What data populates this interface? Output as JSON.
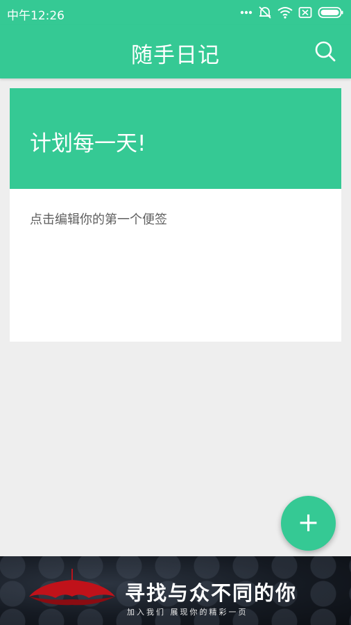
{
  "status_bar": {
    "time": "中午12:26",
    "icons": [
      "more-dots-icon",
      "alarm-off-icon",
      "wifi-icon",
      "sim-card-icon",
      "battery-icon"
    ]
  },
  "app_bar": {
    "title": "随手日记",
    "search_icon": "search-icon"
  },
  "note_card": {
    "header_title": "计划每一天!",
    "body_text": "点击编辑你的第一个便签"
  },
  "fab": {
    "label": "+",
    "icon": "plus-icon"
  },
  "ad_banner": {
    "headline": "寻找与众不同的你",
    "subline": "加入我们 展现你的精彩一页"
  },
  "colors": {
    "accent": "#35c994",
    "background": "#eeeeee",
    "card": "#ffffff",
    "body_text": "#5f5f5f"
  }
}
